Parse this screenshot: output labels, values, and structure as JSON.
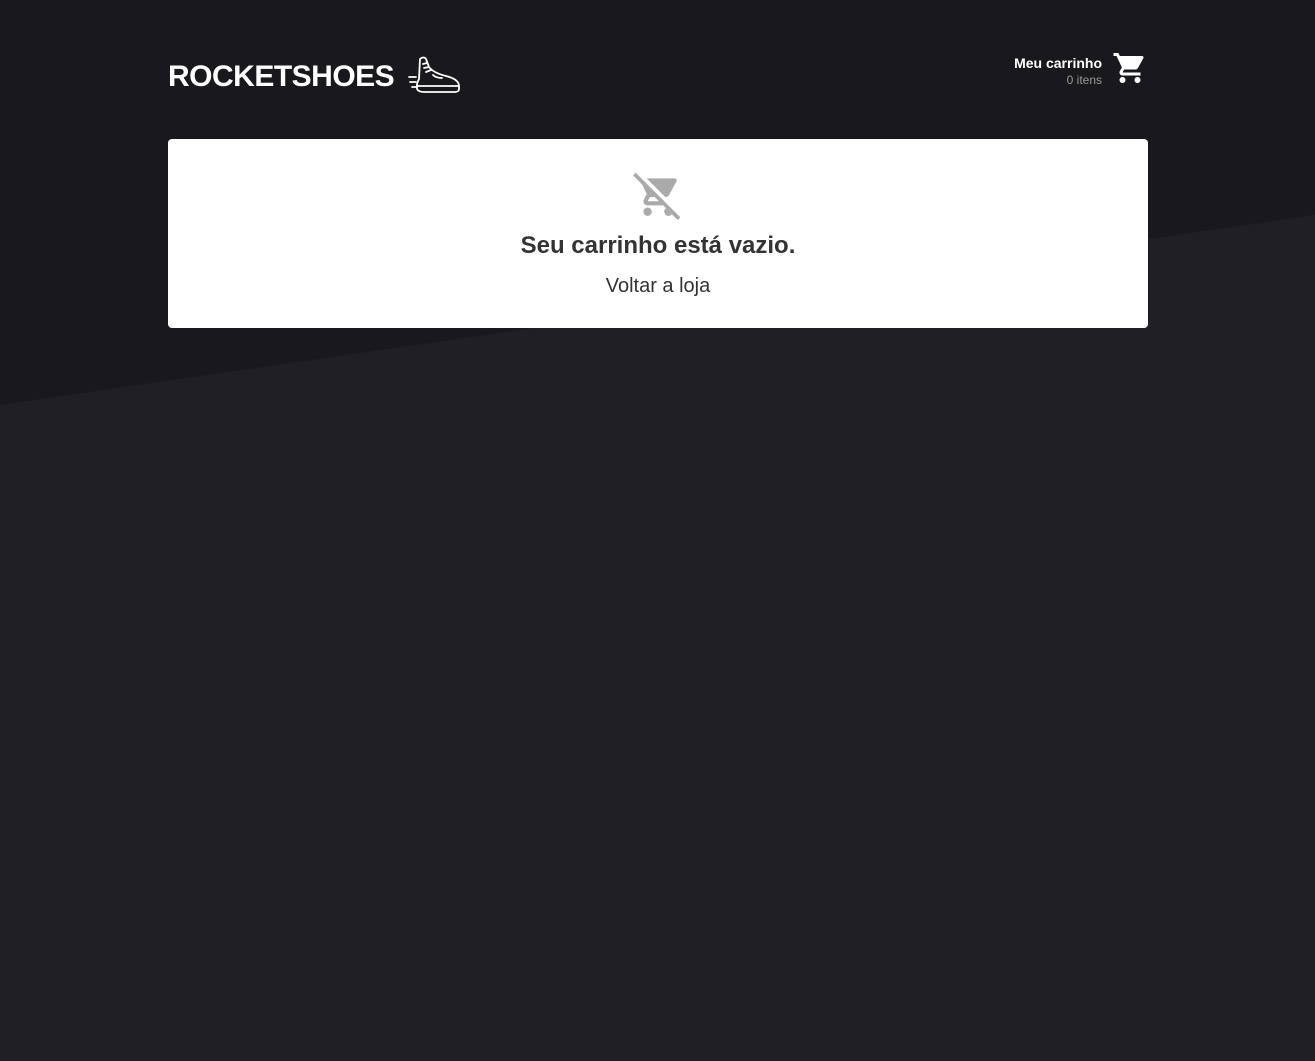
{
  "brand": {
    "name": "ROCKETSHOES",
    "logo_icon": "sneaker-icon"
  },
  "header": {
    "cart": {
      "title": "Meu carrinho",
      "count_text": "0 itens",
      "icon": "shopping-cart-icon"
    }
  },
  "cart_page": {
    "empty_icon": "remove-shopping-cart-icon",
    "empty_message": "Seu carrinho está vazio.",
    "back_link_label": "Voltar a loja"
  },
  "colors": {
    "background": "#202024",
    "background_top": "#191920",
    "panel": "#ffffff",
    "text_dark": "#333333",
    "text_muted": "#999999",
    "icon_muted": "#aaaaaa"
  }
}
